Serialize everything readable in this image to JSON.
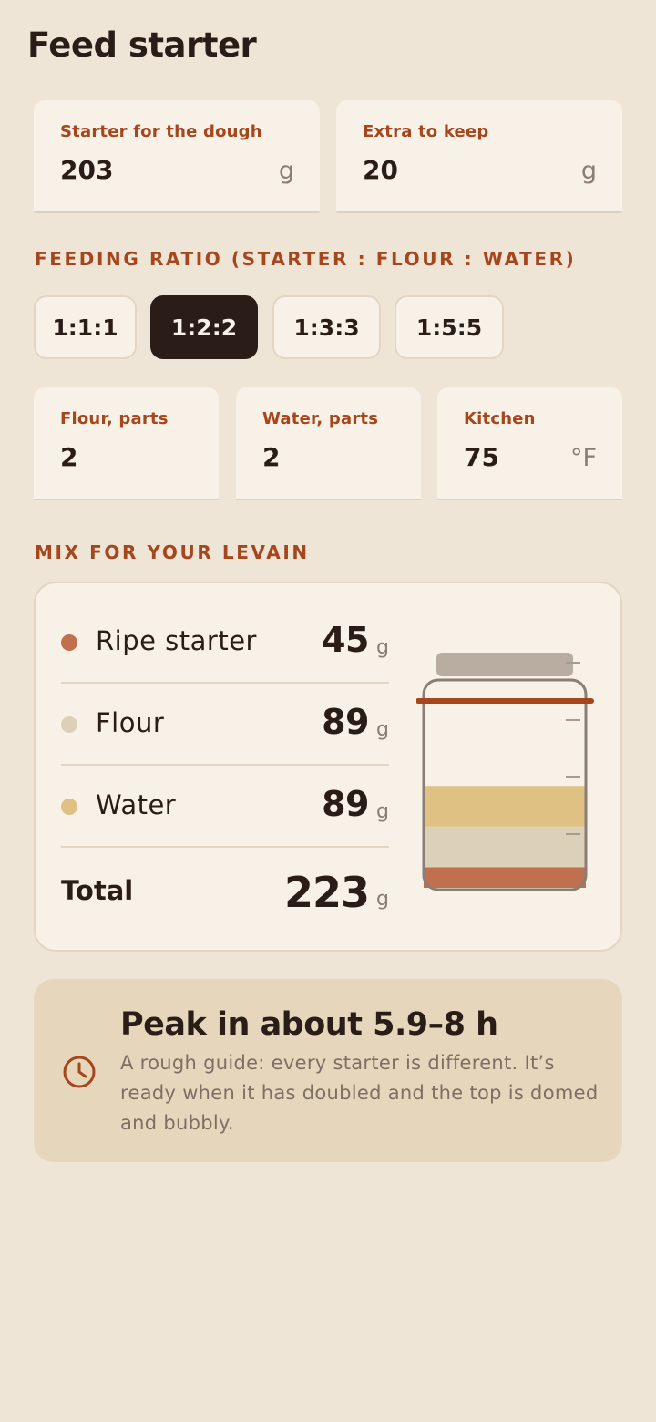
{
  "header": {
    "title": "Feed starter"
  },
  "inputs": {
    "starter_for_dough": {
      "label": "Starter for the dough",
      "value": "203",
      "unit": "g"
    },
    "extra_to_keep": {
      "label": "Extra to keep",
      "value": "20",
      "unit": "g"
    }
  },
  "ratio": {
    "section_label": "FEEDING RATIO (STARTER : FLOUR : WATER)",
    "options": [
      "1:1:1",
      "1:2:2",
      "1:3:3",
      "1:5:5"
    ],
    "selected": "1:2:2"
  },
  "params": {
    "flour_parts": {
      "label": "Flour, parts",
      "value": "2"
    },
    "water_parts": {
      "label": "Water, parts",
      "value": "2"
    },
    "kitchen": {
      "label": "Kitchen",
      "value": "75",
      "unit": "°F"
    }
  },
  "mix": {
    "section_label": "MIX FOR YOUR LEVAIN",
    "unit": "g",
    "items": [
      {
        "name": "Ripe starter",
        "amount": "45",
        "color": "#c0704f"
      },
      {
        "name": "Flour",
        "amount": "89",
        "color": "#ddd0b8"
      },
      {
        "name": "Water",
        "amount": "89",
        "color": "#dfc184"
      }
    ],
    "total": {
      "label": "Total",
      "amount": "223"
    }
  },
  "jar_fill": {
    "starter": 45,
    "flour": 89,
    "water": 89,
    "capacity": 451
  },
  "peak": {
    "title": "Peak in about 5.9–8 h",
    "body": "A rough guide: every starter is different. It’s ready when it has doubled and the top is domed and bubbly."
  },
  "colors": {
    "accent": "#a6461c",
    "dark": "#2a1d17",
    "background": "#efe5d6",
    "card": "#f8f1e7"
  }
}
